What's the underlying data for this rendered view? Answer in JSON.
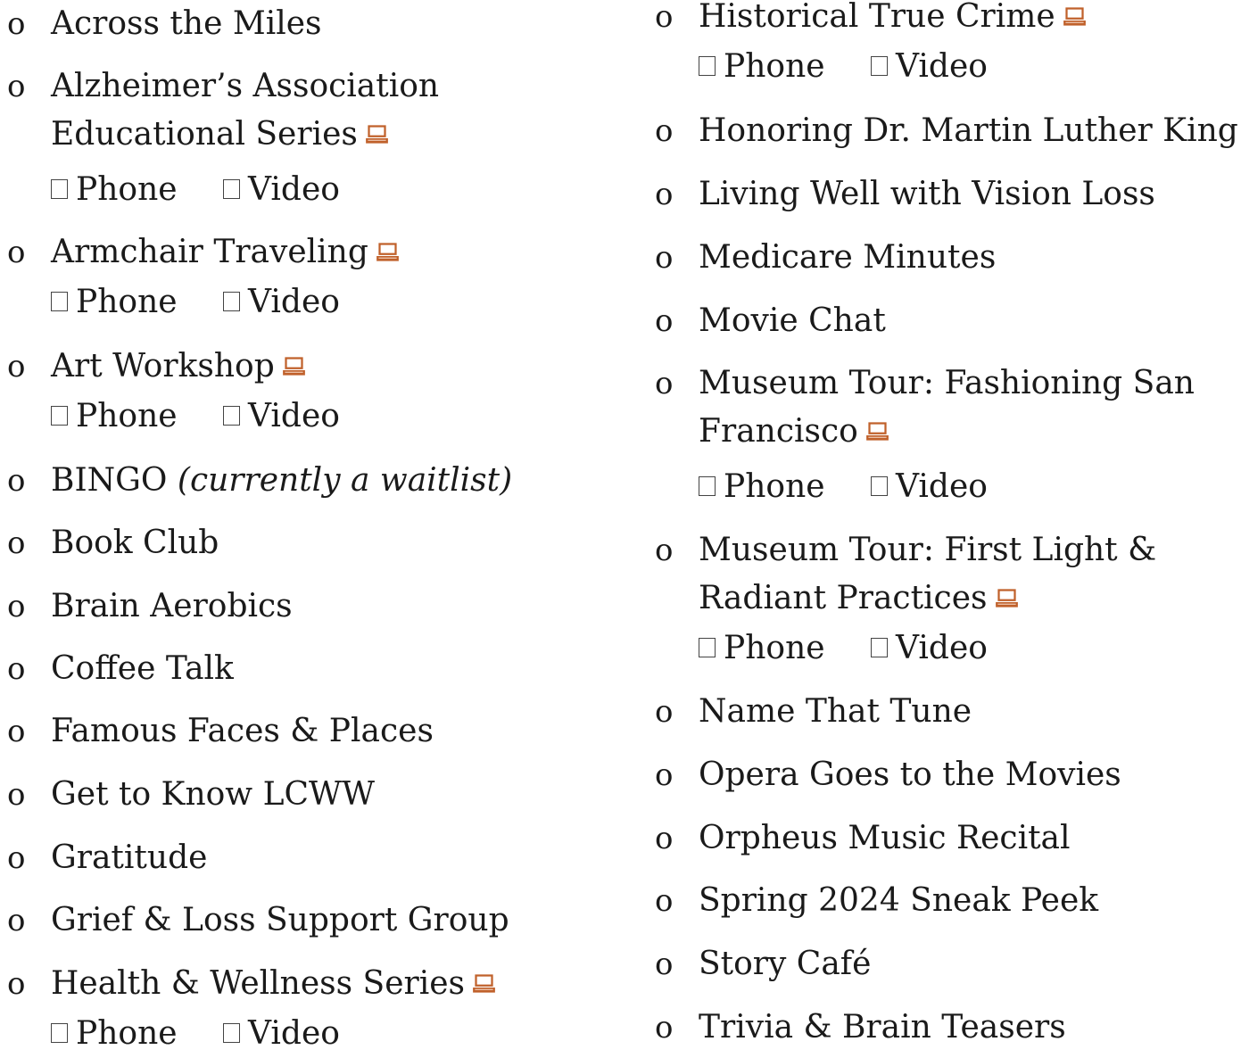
{
  "icons": {
    "laptop": "laptop-icon",
    "checkbox": "checkbox-icon",
    "accent_color": "#c0612b"
  },
  "bullet_glyph": "o",
  "options": {
    "phone": "Phone",
    "video": "Video"
  },
  "left_column": [
    {
      "label": "Across the Miles"
    },
    {
      "label_line1": "Alzheimer’s Association",
      "label_line2": "Educational Series",
      "laptop": true,
      "options": true
    },
    {
      "label": "Armchair Traveling",
      "laptop": true,
      "options": true
    },
    {
      "label": "Art Workshop",
      "laptop": true,
      "options": true
    },
    {
      "label": "BINGO",
      "note": "(currently a waitlist)"
    },
    {
      "label": "Book Club"
    },
    {
      "label": "Brain Aerobics"
    },
    {
      "label": "Coffee Talk"
    },
    {
      "label": "Famous Faces & Places"
    },
    {
      "label": "Get to Know LCWW"
    },
    {
      "label": "Gratitude"
    },
    {
      "label": "Grief & Loss Support Group"
    },
    {
      "label": "Health & Wellness Series",
      "laptop": true,
      "options": true
    }
  ],
  "right_column": [
    {
      "label": "Historical True Crime",
      "laptop": true,
      "options": true
    },
    {
      "label": "Honoring Dr. Martin Luther King"
    },
    {
      "label": "Living Well with Vision Loss"
    },
    {
      "label": "Medicare Minutes"
    },
    {
      "label": "Movie Chat"
    },
    {
      "label_line1": "Museum Tour: Fashioning San",
      "label_line2": "Francisco",
      "laptop": true,
      "options": true
    },
    {
      "label_line1": "Museum Tour: First Light &",
      "label_line2": "Radiant Practices",
      "laptop": true,
      "options": true
    },
    {
      "label": "Name That Tune"
    },
    {
      "label": "Opera Goes to the Movies"
    },
    {
      "label": "Orpheus Music Recital"
    },
    {
      "label": "Spring 2024 Sneak Peek"
    },
    {
      "label": "Story Café"
    },
    {
      "label": "Trivia & Brain Teasers"
    }
  ]
}
